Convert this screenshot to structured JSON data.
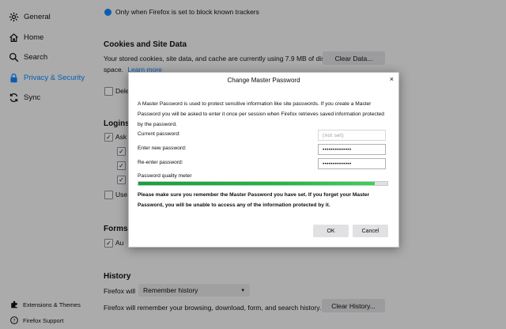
{
  "sidebar": {
    "items": [
      {
        "label": "General",
        "icon": "gear-icon"
      },
      {
        "label": "Home",
        "icon": "home-icon"
      },
      {
        "label": "Search",
        "icon": "search-icon"
      },
      {
        "label": "Privacy & Security",
        "icon": "lock-icon"
      },
      {
        "label": "Sync",
        "icon": "sync-icon"
      }
    ],
    "footer": [
      {
        "label": "Extensions & Themes",
        "icon": "puzzle-icon"
      },
      {
        "label": "Firefox Support",
        "icon": "help-icon"
      }
    ],
    "accent_color": "#0a84ff"
  },
  "main": {
    "top_radio_label": "Only when Firefox is set to block known trackers",
    "cookies": {
      "title": "Cookies and Site Data",
      "desc_line1": "Your stored cookies, site data, and cache are currently using 7.9 MB of disk",
      "desc_line2": "space.",
      "learn_more": "Learn more",
      "clear_data_button": "Clear Data...",
      "delete_partial": "Dele"
    },
    "logins": {
      "title": "Logins",
      "ask_partial": "Ask",
      "use_partial": "Use"
    },
    "forms": {
      "title": "Forms",
      "auto_partial": "Au"
    },
    "history": {
      "title": "History",
      "firefox_will": "Firefox will",
      "select_value": "Remember history",
      "desc": "Firefox will remember your browsing, download, form, and search history.",
      "clear_history_button": "Clear History..."
    }
  },
  "dialog": {
    "title": "Change Master Password",
    "close": "×",
    "description": "A Master Password is used to protect sensitive information like site passwords. If you create a Master Password you will be asked to enter it once per session when Firefox retrieves saved information protected by the password.",
    "current_label": "Current password:",
    "current_value": "(not set)",
    "new_label": "Enter new password:",
    "new_value": "••••••••••••••",
    "reenter_label": "Re-enter password:",
    "reenter_value": "••••••••••••••",
    "meter_label": "Password quality meter",
    "meter_fraction": 0.95,
    "warning": "Please make sure you remember the Master Password you have set. If you forget your Master Password, you will be unable to access any of the information protected by it.",
    "ok": "OK",
    "cancel": "Cancel"
  }
}
